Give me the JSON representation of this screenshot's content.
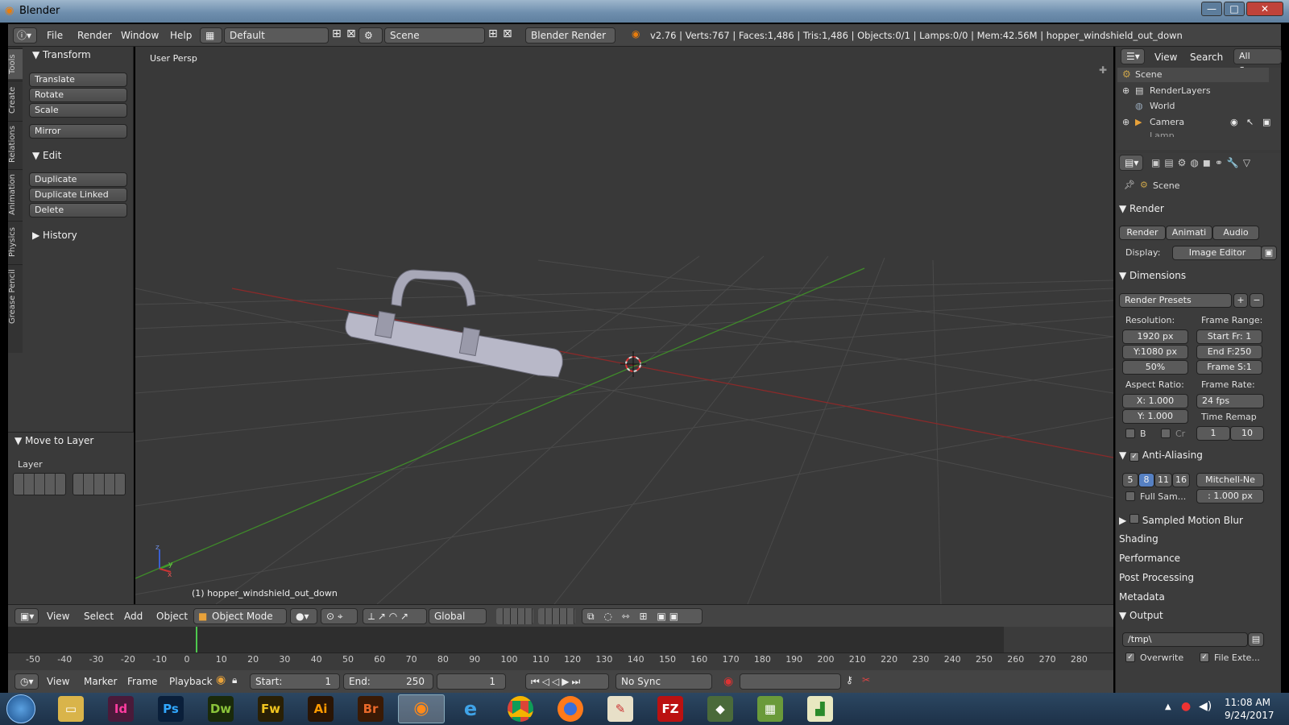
{
  "window": {
    "title": "Blender",
    "min": "—",
    "max": "□",
    "close": "✕"
  },
  "infobar": {
    "menus": [
      "File",
      "Render",
      "Window",
      "Help"
    ],
    "layout": "Default",
    "scene": "Scene",
    "engine": "Blender Render",
    "stats": "v2.76 | Verts:767 | Faces:1,486 | Tris:1,486 | Objects:0/1 | Lamps:0/0 | Mem:42.56M | hopper_windshield_out_down"
  },
  "toolshelf": {
    "tabs": [
      "Tools",
      "Create",
      "Relations",
      "Animation",
      "Physics",
      "Grease Pencil"
    ],
    "transform": {
      "title": "Transform",
      "buttons": [
        "Translate",
        "Rotate",
        "Scale",
        "Mirror"
      ]
    },
    "edit": {
      "title": "Edit",
      "buttons": [
        "Duplicate",
        "Duplicate Linked",
        "Delete"
      ]
    },
    "history": "History",
    "move_to_layer": "Move to Layer",
    "layer": "Layer"
  },
  "viewport": {
    "view_name": "User Persp",
    "object_label": "(1) hopper_windshield_out_down",
    "axis_x": "x",
    "axis_y": "y",
    "axis_z": "z"
  },
  "vpheader": {
    "menus": [
      "View",
      "Select",
      "Add",
      "Object"
    ],
    "mode": "Object Mode",
    "orientation": "Global"
  },
  "timeline": {
    "ticks": [
      "-50",
      "-40",
      "-30",
      "-20",
      "-10",
      "0",
      "10",
      "20",
      "30",
      "40",
      "50",
      "60",
      "70",
      "80",
      "90",
      "100",
      "110",
      "120",
      "130",
      "140",
      "150",
      "160",
      "170",
      "180",
      "190",
      "200",
      "210",
      "220",
      "230",
      "240",
      "250",
      "260",
      "270",
      "280"
    ],
    "current": 0
  },
  "tlheader": {
    "menus": [
      "View",
      "Marker",
      "Frame",
      "Playback"
    ],
    "start_label": "Start:",
    "start": "1",
    "end_label": "End:",
    "end": "250",
    "current": "1",
    "sync": "No Sync"
  },
  "outliner": {
    "menus": [
      "View",
      "Search",
      "All Scenes"
    ],
    "items": [
      "Scene",
      "RenderLayers",
      "World",
      "Camera",
      "Lamp"
    ]
  },
  "props": {
    "scene": "Scene",
    "render_title": "Render",
    "render_btns": [
      "Render",
      "Animati",
      "Audio"
    ],
    "display_label": "Display:",
    "display": "Image Editor",
    "dimensions": "Dimensions",
    "presets": "Render Presets",
    "resolution": "Resolution:",
    "res_x": "1920 px",
    "res_y": "Y:1080 px",
    "res_pct": "50%",
    "frame_range": "Frame Range:",
    "start_fr": "Start Fr: 1",
    "end_f": "End F:250",
    "frame_s": "Frame S:1",
    "aspect": "Aspect Ratio:",
    "asp_x": "1.000",
    "asp_y": "1.000",
    "asp_x_label": "X:",
    "asp_y_label": "Y:",
    "frame_rate": "Frame Rate:",
    "fps": "24 fps",
    "time_remap": "Time Remap",
    "remap_a": "1",
    "remap_b": "10",
    "b": "B",
    "cr": "Cr",
    "aa": "Anti-Aliasing",
    "aa_samples": [
      "5",
      "8",
      "11",
      "16"
    ],
    "aa_filter": "Mitchell-Ne",
    "full_sam": "Full Sam...",
    "filter_size": ": 1.000 px",
    "panels": [
      "Sampled Motion Blur",
      "Shading",
      "Performance",
      "Post Processing",
      "Metadata"
    ],
    "output": "Output",
    "output_path": "/tmp\\",
    "overwrite": "Overwrite",
    "file_ext": "File Exte..."
  },
  "taskbar": {
    "apps": [
      "Id",
      "Ps",
      "Dw",
      "Fw",
      "Ai",
      "Br"
    ],
    "time": "11:08 AM",
    "date": "9/24/2017"
  }
}
